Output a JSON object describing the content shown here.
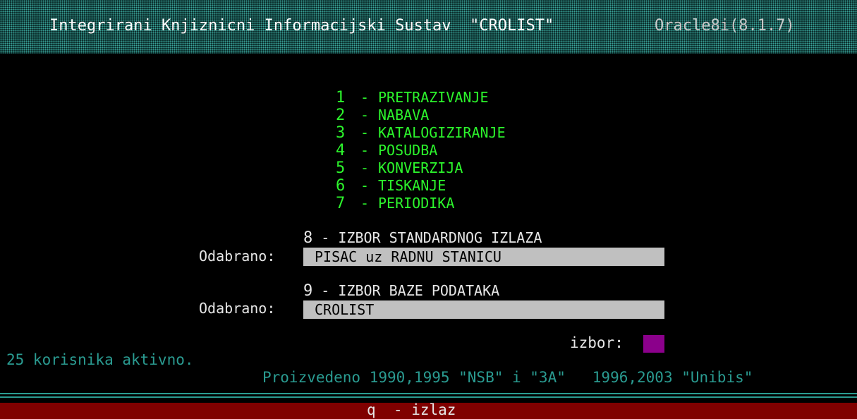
{
  "header": {
    "title": "Integrirani Knjiznicni Informacijski Sustav  \"CROLIST\"",
    "version": "Oracle8i(8.1.7)"
  },
  "menu": [
    {
      "num": "1",
      "sep": "-",
      "label": "PRETRAZIVANJE"
    },
    {
      "num": "2",
      "sep": "-",
      "label": "NABAVA"
    },
    {
      "num": "3",
      "sep": "-",
      "label": "KATALOGIZIRANJE"
    },
    {
      "num": "4",
      "sep": "-",
      "label": "POSUDBA"
    },
    {
      "num": "5",
      "sep": "-",
      "label": "KONVERZIJA"
    },
    {
      "num": "6",
      "sep": "-",
      "label": "TISKANJE"
    },
    {
      "num": "7",
      "sep": "-",
      "label": "PERIODIKA"
    }
  ],
  "output_option": {
    "num": "8",
    "title": " - IZBOR STANDARDNOG IZLAZA",
    "selected_label": "Odabrano:",
    "selected_value": "PISAC uz RADNU STANICU"
  },
  "database_option": {
    "num": "9",
    "title": " - IZBOR BAZE PODATAKA",
    "selected_label": "Odabrano:",
    "selected_value": "CROLIST"
  },
  "prompt": {
    "label": "izbor:",
    "value": ""
  },
  "status": {
    "active_users": "25 korisnika aktivno.",
    "credits": "Proizvedeno 1990,1995 \"NSB\" i \"3A\"   1996,2003 \"Unibis\""
  },
  "footer": {
    "exit_label": "q  - izlaz"
  },
  "colors": {
    "background": "#000000",
    "menu_text": "#2cf52c",
    "header_teal": "#2a9b91",
    "field_gray": "#c0c0c0",
    "input_magenta": "#8b008b",
    "footer_bar": "#800000"
  }
}
